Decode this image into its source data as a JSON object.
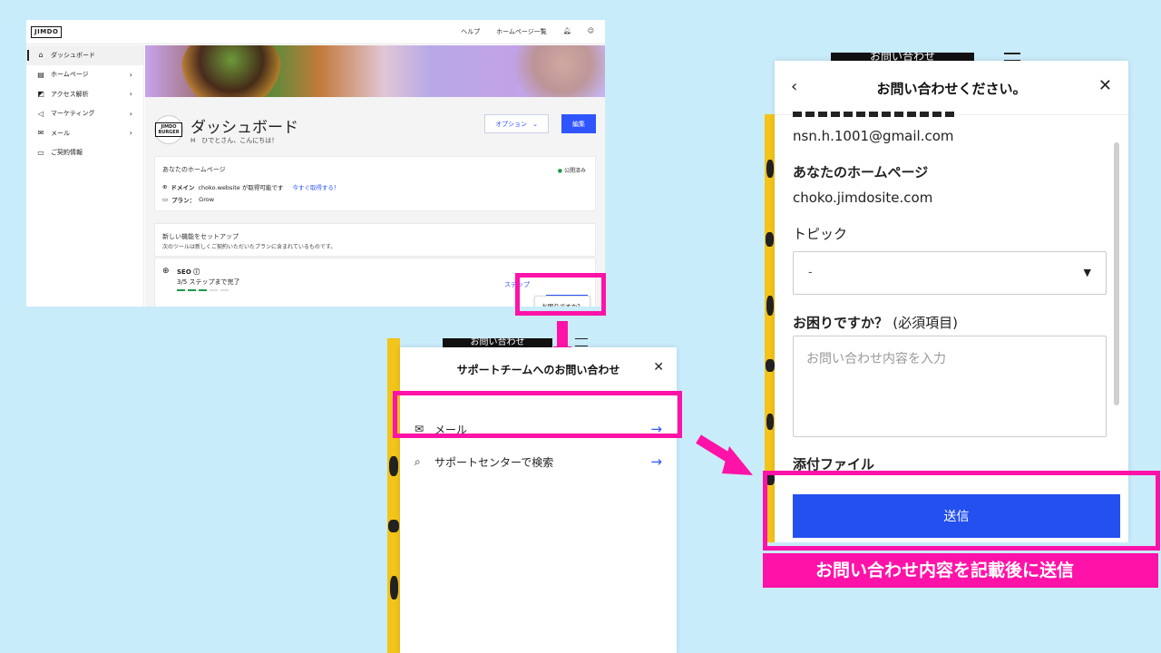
{
  "colors": {
    "highlight": "#ff12a8",
    "accent": "#2f55ff",
    "sidebar_yellow": "#f3c41a",
    "background": "#c9ecfb"
  },
  "dashboard": {
    "logo": "JIMDO",
    "topnav": [
      "ヘルプ",
      "ホームページ一覧"
    ],
    "sidebar": [
      {
        "label": "ダッシュボード",
        "icon": "home-icon"
      },
      {
        "label": "ホームページ",
        "icon": "layout-icon"
      },
      {
        "label": "アクセス解析",
        "icon": "chart-icon"
      },
      {
        "label": "マーケティング",
        "icon": "megaphone-icon"
      },
      {
        "label": "メール",
        "icon": "mail-icon"
      },
      {
        "label": "ご契約情報",
        "icon": "card-icon"
      }
    ],
    "avatar_text": "JIMDO BURGER",
    "title": "ダッシュボード",
    "greeting": "H　ひでとさん、こんにちは！",
    "options_label": "オプション",
    "edit_label": "編集",
    "site_card": {
      "title": "あなたのホームページ",
      "status": "公開済み",
      "domain_label": "ドメイン",
      "domain_text": "choko.website が取得可能です",
      "domain_link": "今すぐ取得する！",
      "plan_label": "プラン：",
      "plan_value": "Grow"
    },
    "setup_card": {
      "title": "新しい機能をセットアップ",
      "subtitle": "次のツールは新しくご契約いただいたプランに含まれているものです。"
    },
    "seo_card": {
      "title": "SEO",
      "steps": "3/5 ステップまで完了",
      "step_link": "ステップ"
    },
    "help_popup": "お困りですか？"
  },
  "support": {
    "top_bar_text": "お問い合わせ",
    "title": "サポートチームへのお問い合わせ",
    "items": [
      {
        "label": "メール",
        "icon": "mail-icon"
      },
      {
        "label": "サポートセンターで検索",
        "icon": "search-icon"
      }
    ]
  },
  "contact_form": {
    "top_bar_text": "お問い合わせ",
    "title": "お問い合わせください。",
    "email_value": "nsn.h.1001@gmail.com",
    "homepage_label": "あなたのホームページ",
    "homepage_value": "choko.jimdosite.com",
    "topic_label": "トピック",
    "topic_value": "-",
    "question_label": "お困りですか？",
    "required_note": "(必須項目)",
    "message_placeholder": "お問い合わせ内容を入力",
    "attachment_label": "添付ファイル",
    "send_label": "送信"
  },
  "caption": "お問い合わせ内容を記載後に送信"
}
